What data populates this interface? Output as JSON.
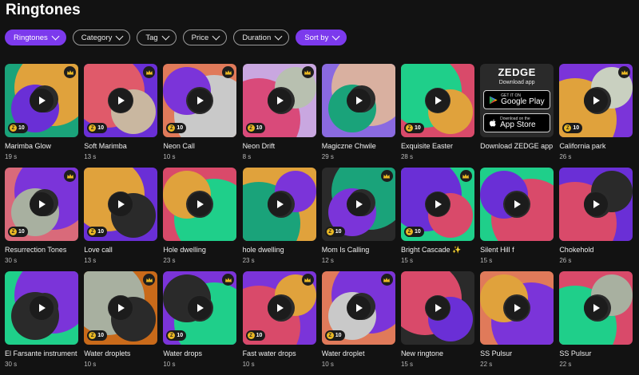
{
  "page": {
    "title": "Ringtones"
  },
  "filters": [
    {
      "label": "Ringtones",
      "active": true
    },
    {
      "label": "Category",
      "active": false
    },
    {
      "label": "Tag",
      "active": false
    },
    {
      "label": "Price",
      "active": false
    },
    {
      "label": "Duration",
      "active": false
    },
    {
      "label": "Sort by",
      "active": true
    }
  ],
  "promo": {
    "logo": "ZEDGE",
    "subtitle": "Download app",
    "google_small": "GET IT ON",
    "google_big": "Google Play",
    "apple_small": "Download on the",
    "apple_big": "App Store",
    "name": "Download ZEDGE app"
  },
  "colors": {
    "accent": "#7c3aed",
    "background": "#121212",
    "coin": "#e9b824"
  },
  "icons": {
    "premium": "crown-icon",
    "play": "play-icon",
    "coin": "coin-icon"
  },
  "items": [
    {
      "name": "Marimba Glow",
      "duration": "19 s",
      "price": "10",
      "premium": true,
      "colors": [
        "#1aa37a",
        "#e0a23c",
        "#6a2fd6",
        "#2b2b2b"
      ]
    },
    {
      "name": "Soft Marimba",
      "duration": "13 s",
      "price": "10",
      "premium": true,
      "colors": [
        "#6a2fd6",
        "#e05a6a",
        "#c9b7a0",
        "#2b2b2b"
      ]
    },
    {
      "name": "Neon Call",
      "duration": "10 s",
      "price": "10",
      "premium": true,
      "colors": [
        "#e07a5a",
        "#c9c9c9",
        "#7b34d9",
        "#2b2b2b"
      ]
    },
    {
      "name": "Neon Drift",
      "duration": "8 s",
      "price": "10",
      "premium": true,
      "colors": [
        "#c9a7e0",
        "#d94a7a",
        "#b8c0b0",
        "#2b2b2b"
      ]
    },
    {
      "name": "Magiczne Chwile",
      "duration": "29 s",
      "price": "",
      "premium": false,
      "colors": [
        "#8a6ae0",
        "#d9b0a0",
        "#1aa37a",
        "#2b2b2b"
      ]
    },
    {
      "name": "Exquisite Easter",
      "duration": "28 s",
      "price": "10",
      "premium": false,
      "colors": [
        "#d94a6a",
        "#1fcf8a",
        "#e0a23c",
        "#2b2b2b"
      ]
    },
    {
      "promo": true
    },
    {
      "name": "California park",
      "duration": "26 s",
      "price": "10",
      "premium": true,
      "colors": [
        "#7b34d9",
        "#e0a23c",
        "#c9d0c0",
        "#2b2b2b"
      ]
    },
    {
      "name": "Resurrection Tones",
      "duration": "30 s",
      "price": "10",
      "premium": true,
      "colors": [
        "#d96a7a",
        "#7b34d9",
        "#a8b0a0",
        "#2b2b2b"
      ]
    },
    {
      "name": "Love call",
      "duration": "13 s",
      "price": "10",
      "premium": false,
      "colors": [
        "#6a2fd6",
        "#e0a23c",
        "#2a2a2a",
        "#2b2b2b"
      ]
    },
    {
      "name": "Hole dwelling",
      "duration": "23 s",
      "price": "",
      "premium": false,
      "colors": [
        "#d94a6a",
        "#1fcf8a",
        "#e0a23c",
        "#2b2b2b"
      ]
    },
    {
      "name": "hole dwelling",
      "duration": "23 s",
      "price": "",
      "premium": false,
      "colors": [
        "#e0a23c",
        "#1aa37a",
        "#7b34d9",
        "#2b2b2b"
      ]
    },
    {
      "name": "Mom Is Calling",
      "duration": "12 s",
      "price": "10",
      "premium": true,
      "colors": [
        "#2a2a2a",
        "#1aa37a",
        "#7b34d9",
        "#2b2b2b"
      ]
    },
    {
      "name": "Bright Cascade ✨",
      "duration": "15 s",
      "price": "10",
      "premium": true,
      "colors": [
        "#1fcf8a",
        "#6a2fd6",
        "#d94a6a",
        "#2b2b2b"
      ]
    },
    {
      "name": "Silent Hill f",
      "duration": "15 s",
      "price": "",
      "premium": false,
      "colors": [
        "#1fcf8a",
        "#d94a6a",
        "#6a2fd6",
        "#2b2b2b"
      ]
    },
    {
      "name": "Chokehold",
      "duration": "26 s",
      "price": "",
      "premium": false,
      "colors": [
        "#6a2fd6",
        "#d94a6a",
        "#2a2a2a",
        "#2b2b2b"
      ]
    },
    {
      "name": "El Farsante instrument",
      "duration": "30 s",
      "price": "",
      "premium": false,
      "colors": [
        "#1fcf8a",
        "#7b34d9",
        "#2a2a2a",
        "#2b2b2b"
      ]
    },
    {
      "name": "Water droplets",
      "duration": "10 s",
      "price": "10",
      "premium": true,
      "colors": [
        "#c96a1a",
        "#a8b0a0",
        "#2a2a2a",
        "#2b2b2b"
      ]
    },
    {
      "name": "Water drops",
      "duration": "10 s",
      "price": "10",
      "premium": true,
      "colors": [
        "#7b34d9",
        "#1fcf8a",
        "#2a2a2a",
        "#2b2b2b"
      ]
    },
    {
      "name": "Fast water drops",
      "duration": "10 s",
      "price": "10",
      "premium": true,
      "colors": [
        "#7b34d9",
        "#d94a6a",
        "#e0a23c",
        "#2b2b2b"
      ]
    },
    {
      "name": "Water droplet",
      "duration": "10 s",
      "price": "10",
      "premium": true,
      "colors": [
        "#e07a5a",
        "#7b34d9",
        "#c9c9c9",
        "#2b2b2b"
      ]
    },
    {
      "name": "New ringtone",
      "duration": "15 s",
      "price": "",
      "premium": false,
      "colors": [
        "#2a2a2a",
        "#d94a6a",
        "#6a2fd6",
        "#2b2b2b"
      ]
    },
    {
      "name": "SS Pulsur",
      "duration": "22 s",
      "price": "",
      "premium": false,
      "colors": [
        "#e07a5a",
        "#7b34d9",
        "#e0a23c",
        "#2b2b2b"
      ]
    },
    {
      "name": "SS Pulsur",
      "duration": "22 s",
      "price": "",
      "premium": false,
      "colors": [
        "#d94a6a",
        "#1fcf8a",
        "#a8b0a0",
        "#2b2b2b"
      ]
    }
  ]
}
